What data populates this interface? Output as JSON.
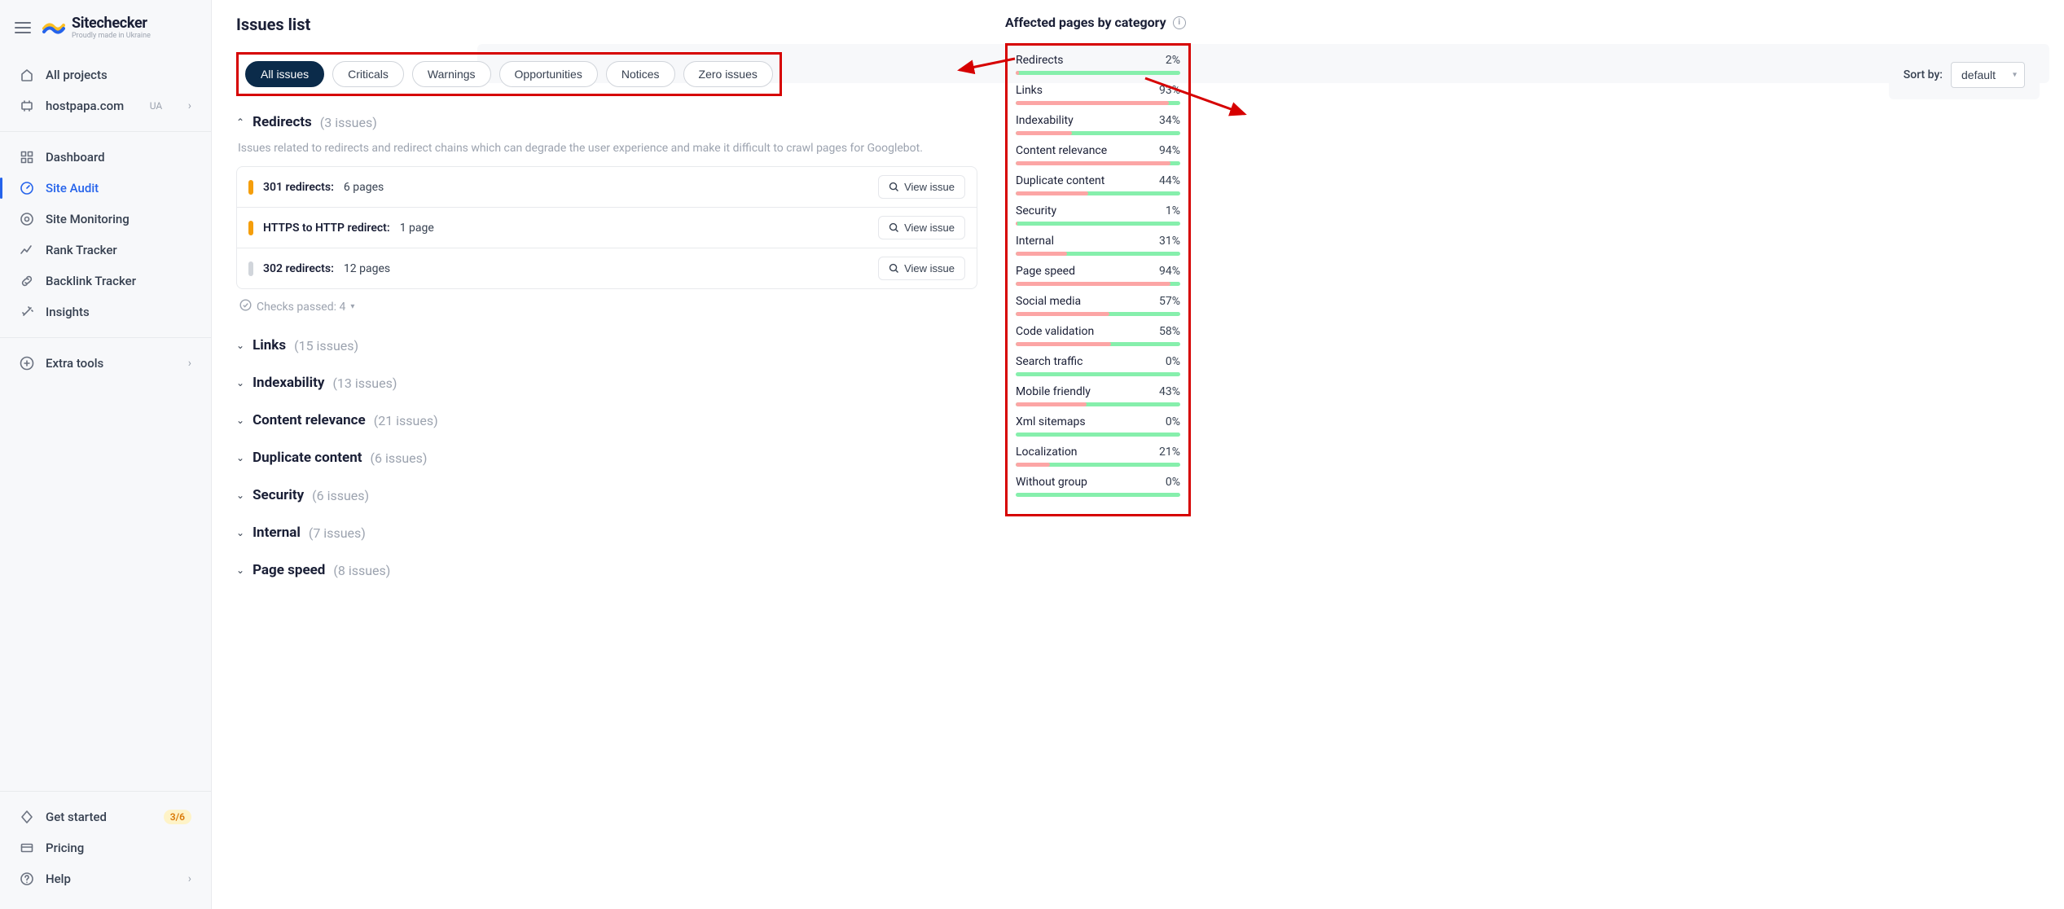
{
  "brand": {
    "name": "Sitechecker",
    "tagline": "Proudly made in Ukraine"
  },
  "sidebar": {
    "top_items": [
      {
        "label": "All projects",
        "icon": "home"
      },
      {
        "label": "hostpapa.com",
        "meta": "UA",
        "icon": "host",
        "chev": true
      }
    ],
    "nav_items": [
      {
        "label": "Dashboard",
        "icon": "grid"
      },
      {
        "label": "Site Audit",
        "icon": "gauge",
        "active": true
      },
      {
        "label": "Site Monitoring",
        "icon": "eye"
      },
      {
        "label": "Rank Tracker",
        "icon": "trend"
      },
      {
        "label": "Backlink Tracker",
        "icon": "link"
      },
      {
        "label": "Insights",
        "icon": "wand"
      }
    ],
    "extra": {
      "label": "Extra tools",
      "icon": "plus",
      "chev": true
    },
    "bottom": [
      {
        "label": "Get started",
        "icon": "diamond",
        "badge": "3/6"
      },
      {
        "label": "Pricing",
        "icon": "card"
      },
      {
        "label": "Help",
        "icon": "help",
        "chev": true
      }
    ]
  },
  "page": {
    "title": "Issues list",
    "filters": [
      "All issues",
      "Criticals",
      "Warnings",
      "Opportunities",
      "Notices",
      "Zero issues"
    ],
    "active_filter": 0,
    "sort_label": "Sort by:",
    "sort_value": "default"
  },
  "redirects": {
    "name": "Redirects",
    "count": "(3 issues)",
    "desc": "Issues related to redirects and redirect chains which can degrade the user experience and make it difficult to crawl pages for Googlebot.",
    "issues": [
      {
        "sev": "warn",
        "name": "301 redirects:",
        "pages": "6 pages"
      },
      {
        "sev": "warn",
        "name": "HTTPS to HTTP redirect:",
        "pages": "1 page"
      },
      {
        "sev": "low",
        "name": "302 redirects:",
        "pages": "12 pages"
      }
    ],
    "checks_passed": "Checks passed: 4",
    "view_label": "View issue"
  },
  "collapsed_sections": [
    {
      "name": "Links",
      "count": "(15 issues)"
    },
    {
      "name": "Indexability",
      "count": "(13 issues)"
    },
    {
      "name": "Content relevance",
      "count": "(21 issues)"
    },
    {
      "name": "Duplicate content",
      "count": "(6 issues)"
    },
    {
      "name": "Security",
      "count": "(6 issues)"
    },
    {
      "name": "Internal",
      "count": "(7 issues)"
    },
    {
      "name": "Page speed",
      "count": "(8 issues)"
    }
  ],
  "right": {
    "title": "Affected pages by category",
    "stats": [
      {
        "name": "Redirects",
        "pct": 2
      },
      {
        "name": "Links",
        "pct": 93
      },
      {
        "name": "Indexability",
        "pct": 34
      },
      {
        "name": "Content relevance",
        "pct": 94
      },
      {
        "name": "Duplicate content",
        "pct": 44
      },
      {
        "name": "Security",
        "pct": 1
      },
      {
        "name": "Internal",
        "pct": 31
      },
      {
        "name": "Page speed",
        "pct": 94
      },
      {
        "name": "Social media",
        "pct": 57
      },
      {
        "name": "Code validation",
        "pct": 58
      },
      {
        "name": "Search traffic",
        "pct": 0
      },
      {
        "name": "Mobile friendly",
        "pct": 43
      },
      {
        "name": "Xml sitemaps",
        "pct": 0
      },
      {
        "name": "Localization",
        "pct": 21
      },
      {
        "name": "Without group",
        "pct": 0
      }
    ]
  }
}
